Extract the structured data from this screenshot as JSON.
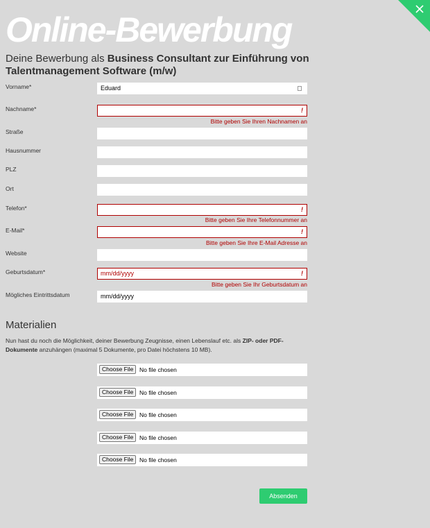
{
  "header": {
    "title": "Online-Bewerbung",
    "subtitle_prefix": "Deine Bewerbung als ",
    "subtitle_job": "Business Consultant zur Einführung von Talentmanagement Software (m/w)"
  },
  "fields": [
    {
      "label": "Vorname*",
      "value": "Eduard",
      "error": ""
    },
    {
      "label": "Nachname*",
      "value": "",
      "error": "Bitte geben Sie Ihren Nachnamen an"
    },
    {
      "label": "Straße",
      "value": "",
      "error": ""
    },
    {
      "label": "Hausnummer",
      "value": "",
      "error": ""
    },
    {
      "label": "PLZ",
      "value": "",
      "error": ""
    },
    {
      "label": "Ort",
      "value": "",
      "error": ""
    },
    {
      "label": "Telefon*",
      "value": "",
      "error": "Bitte geben Sie Ihre Telefonnummer an"
    },
    {
      "label": "E-Mail*",
      "value": "",
      "error": "Bitte geben Sie Ihre E-Mail Adresse an"
    },
    {
      "label": "Website",
      "value": "",
      "error": ""
    },
    {
      "label": "Geburtsdatum*",
      "value": "mm/dd/yyyy",
      "error": "Bitte geben Sie Ihr Geburtsdatum an"
    },
    {
      "label": "Mögliches Eintrittsdatum",
      "value": "mm/dd/yyyy",
      "error": ""
    }
  ],
  "error_marker": "!",
  "materials": {
    "title": "Materialien",
    "intro_before": "Nun hast du noch die Möglichkeit, deiner Bewerbung Zeugnisse, einen Lebenslauf etc. als ",
    "intro_bold": "ZIP- oder PDF-Dokumente",
    "intro_after": " anzuhängen (maximal 5 Dokumente, pro Datei höchstens 10 MB).",
    "file_button_label": "Choose File",
    "file_status": "No file chosen",
    "file_count": 5
  },
  "submit_label": "Absenden",
  "colors": {
    "background": "#d9d9d9",
    "accent": "#2ecc71",
    "error": "#b00000"
  }
}
